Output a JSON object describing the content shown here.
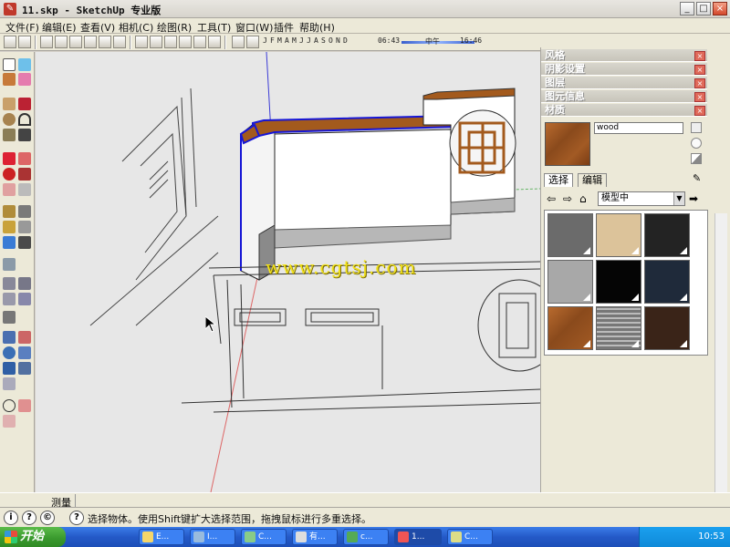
{
  "window": {
    "title": "11.skp - SketchUp 专业版",
    "min_label": "_",
    "max_label": "□",
    "close_label": "×"
  },
  "menu": [
    "文件(F)",
    "编辑(E)",
    "查看(V)",
    "相机(C)",
    "绘图(R)",
    "工具(T)",
    "窗口(W)",
    "插件",
    "帮助(H)"
  ],
  "shadow_bar": {
    "months": [
      "J",
      "F",
      "M",
      "A",
      "M",
      "J",
      "J",
      "A",
      "S",
      "O",
      "N",
      "D"
    ],
    "time_start": "06:43",
    "time_mid": "中午",
    "time_end": "16:46",
    "time_slider_level": 0.56
  },
  "panels": {
    "tray_headers": [
      "风格",
      "阴影设置",
      "图层",
      "图元信息",
      "材质"
    ],
    "material": {
      "name": "wood",
      "tabs": [
        "选择",
        "编辑"
      ],
      "library": "模型中",
      "swatch_colors": [
        "#6b6b6b",
        "#dcc39a",
        "#232323",
        "#a8a8a8",
        "#050505",
        "#1f2a3a",
        "#9a5424",
        "brick",
        "#3a2418"
      ]
    }
  },
  "measurements": {
    "label": "测量",
    "value": ""
  },
  "status": {
    "message": "选择物体。使用Shift键扩大选择范围，拖拽鼠标进行多重选择。",
    "icons": [
      "i",
      "?",
      "©"
    ]
  },
  "viewport": {
    "watermark": "www.cgtsj.com",
    "colors": {
      "background": "#e7e7e7",
      "wall_cap": "#a35a1d",
      "selection": "#1515d6"
    }
  },
  "taskbar": {
    "start_label": "开始",
    "tasks": [
      "E...",
      "I...",
      "C...",
      "有...",
      "c...",
      "1...",
      "C..."
    ],
    "clock": "10:53"
  }
}
